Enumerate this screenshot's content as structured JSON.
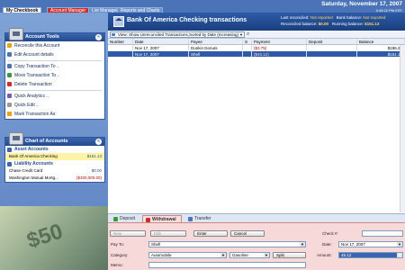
{
  "tabs": [
    "My Checkbook",
    "Account Manager",
    "List Manager",
    "Reports and Charts"
  ],
  "header": {
    "date": "Saturday, November 17, 2007",
    "time": "3:45:22 PM EST",
    "title": "Bank Of America Checking transactions",
    "last_reconciled_label": "Last reconciled:",
    "last_reconciled_value": "Not reported",
    "reconciled_balance_label": "Reconciled balance:",
    "reconciled_balance_value": "$0.00",
    "bank_balance_label": "Bank balance:",
    "bank_balance_value": "Not reported",
    "running_balance_label": "Running balance:",
    "running_balance_value": "$151.13"
  },
  "account_tools": {
    "title": "Account Tools",
    "items": [
      {
        "label": "Reconcile this Account",
        "icon": "reconcile-icon",
        "color": "#e8a317"
      },
      {
        "label": "Edit Account details",
        "icon": "edit-icon",
        "color": "#4a73b8"
      },
      {
        "label": "Copy Transaction To ..",
        "icon": "copy-icon",
        "color": "#4a73b8"
      },
      {
        "label": "Move Transaction To ..",
        "icon": "move-icon",
        "color": "#3a9a3a"
      },
      {
        "label": "Delete Transaction",
        "icon": "delete-icon",
        "color": "#c9302c"
      },
      {
        "label": "Quick Analytics ..",
        "icon": "analytics-icon",
        "color": "#7a5cb8"
      },
      {
        "label": "Quick Edit ..",
        "icon": "quick-edit-icon",
        "color": "#999999"
      },
      {
        "label": "Mark Transaction As:",
        "icon": "mark-icon",
        "color": "#e8a317"
      }
    ]
  },
  "chart_of_accounts": {
    "title": "Chart of Accounts",
    "asset_header": "Asset Accounts",
    "assets": [
      {
        "name": "Bank Of America Checking",
        "amount": "$151.13"
      }
    ],
    "liability_header": "Liability Accounts",
    "liabilities": [
      {
        "name": "Chase Credit Card",
        "amount": "$0.00"
      },
      {
        "name": "Washington Mutual Mortg...",
        "amount": "($100,000.00)"
      }
    ]
  },
  "toolbar": {
    "view": "View: Show Unreconciled Transactions,Sorted by Date (Increasing)"
  },
  "register": {
    "columns": [
      "Number",
      "Date",
      "Payee",
      "S",
      "Payment",
      "Deposit",
      "Balance"
    ],
    "rows": [
      {
        "number": "",
        "date": "Nov 17, 2007",
        "payee": "Dunkin Donuts",
        "s": "",
        "payment": "($3.75)",
        "deposit": "",
        "balance": "$196.25",
        "selected": false
      },
      {
        "number": "",
        "date": "Nov 17, 2007",
        "payee": "Shell",
        "s": "",
        "payment": "($45.12)",
        "deposit": "",
        "balance": "$151.13",
        "selected": true
      }
    ]
  },
  "entry_tabs": [
    "Deposit",
    "Withdrawal",
    "Transfer"
  ],
  "entry_tab_colors": [
    "#3a9a3a",
    "#c9302c",
    "#4a73b8"
  ],
  "form": {
    "new_label": "New",
    "edit_label": "Edit",
    "enter_label": "Enter",
    "cancel_label": "Cancel",
    "check_label": "Check #:",
    "check_value": "",
    "payto_label": "Pay To:",
    "payto_value": "Shell",
    "date_label": "Date:",
    "date_value": "Nov 17, 2007",
    "category_label": "Category:",
    "category_value": "Automobile",
    "subcategory_value": "Gasoline",
    "split_label": "Split",
    "amount_label": "Amount:",
    "amount_value": "45.12",
    "memo_label": "Memo:",
    "memo_value": ""
  }
}
